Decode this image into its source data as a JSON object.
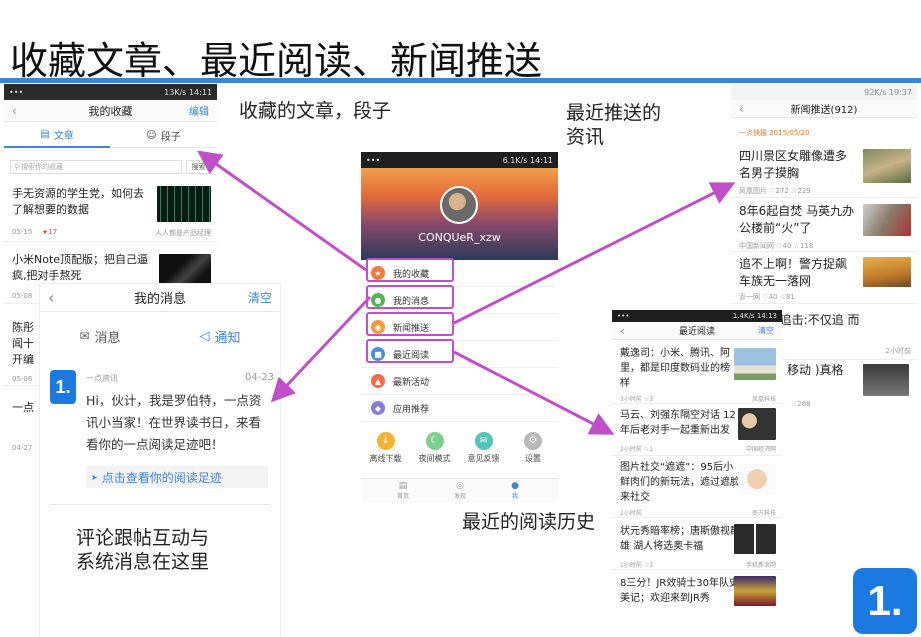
{
  "slide": {
    "title": "收藏文章、最近阅读、新闻推送",
    "captions": {
      "favorites": "收藏的文章，段子",
      "push_line1": "最近推送的",
      "push_line2": "资讯",
      "recent": "最近的阅读历史",
      "messages_line1": "评论跟帖互动与",
      "messages_line2": "系统消息在这里"
    }
  },
  "favorites_screen": {
    "status": "13K/s 14:11",
    "title": "我的收藏",
    "edit": "编辑",
    "tab_articles": "文章",
    "tab_jokes": "段子",
    "search_placeholder": "搜索你的收藏",
    "search_button": "搜索",
    "items": [
      {
        "title": "手无资源的学生党，如何去了解想要的数据",
        "date": "05-15",
        "count": "★17",
        "source": "人人都是产品经理"
      },
      {
        "title": "小米Note顶配版；把自己逼疯,把对手熬死",
        "date": "05-08"
      },
      {
        "title": "陈彤 闻十 开编",
        "date": "05-06"
      },
      {
        "title": "一点",
        "date": "04-27"
      }
    ]
  },
  "messages_screen": {
    "title": "我的消息",
    "clear": "清空",
    "tab_messages": "消息",
    "tab_notices": "通知",
    "sender": "一点资讯",
    "date": "04-23",
    "logo": "1.",
    "body": "Hi，伙计，我是罗伯特，一点资讯小当家！在世界读书日，来看看你的一点阅读足迹吧！",
    "link": "点击查看你的阅读足迹"
  },
  "profile_screen": {
    "status": "6.1K/s 14:11",
    "username": "CONQUeR_xzw",
    "menu": [
      {
        "label": "我的收藏",
        "color": "#f07a3a",
        "glyph": "★"
      },
      {
        "label": "我的消息",
        "color": "#4db84d",
        "glyph": "●"
      },
      {
        "label": "新闻推送",
        "color": "#f59a3a",
        "glyph": "◉"
      },
      {
        "label": "最近阅读",
        "color": "#4a8fe0",
        "glyph": "■"
      },
      {
        "label": "最新活动",
        "color": "#f06b4a",
        "glyph": "▲"
      },
      {
        "label": "应用推荐",
        "color": "#8a7ae0",
        "glyph": "◆"
      }
    ],
    "tools": [
      {
        "label": "离线下载",
        "color": "#f5b233"
      },
      {
        "label": "夜间模式",
        "color": "#7ad08f"
      },
      {
        "label": "意见反馈",
        "color": "#52c4b8"
      },
      {
        "label": "设置",
        "color": "#b9b9b9"
      }
    ],
    "nav": [
      "首页",
      "发现",
      "我"
    ]
  },
  "push_screen": {
    "status": "92K/s 19:37",
    "title": "新闻推送(912)",
    "date_label": "一点快报 2015/05/20",
    "items": [
      {
        "title": "四川景区女雕像遭多名男子摸胸",
        "meta": "凤凰图片 ♡272 ☆229"
      },
      {
        "title": "8年6起自焚 马英九办公楼前“火”了",
        "meta": "中国新闻网 ♡40 ☆118"
      },
      {
        "title": "追不上啊！警方捉飙车族无一落网",
        "meta": "澎一网 ♡40 ☆81"
      },
      {
        "title": "]美警察追击:不仅追 而",
        "meta": "2小时前"
      },
      {
        "title": "式停机！移动 )真格 联通…",
        "meta": "☆268"
      }
    ]
  },
  "recent_screen": {
    "status": "1.4K/s 14:13",
    "title": "最近阅读",
    "clear": "清空",
    "items": [
      {
        "title": "戴逸司：小米、腾讯、阿里，都是印度数码业的榜样",
        "meta": "3小时前 ☆3",
        "source": "凤凰科技"
      },
      {
        "title": "马云、刘强东隔空对话 12年后老对手一起重新出发",
        "meta": "2小时前 ☆1",
        "source": "中国经济网"
      },
      {
        "title": "图片社交“遮遮”：95后小鲜肉们的新玩法，遮过遮脸来社交",
        "meta": "2小时前",
        "source": "南方科技"
      },
      {
        "title": "状元秀暗率榜；唐斯傲视群雄 湖人将选奥卡福",
        "meta": "1小时前 ☆3",
        "source": "手机新浪网"
      },
      {
        "title": "8三分！JR效骑士30年队史 美记；欢迎来到JR秀",
        "meta": "",
        "source": ""
      }
    ]
  },
  "brand": {
    "logo": "1."
  }
}
